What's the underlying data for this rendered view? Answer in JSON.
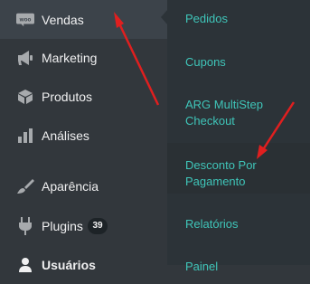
{
  "sidebar": {
    "items": [
      {
        "label": "Vendas",
        "icon": "woo-icon",
        "active": true
      },
      {
        "label": "Marketing",
        "icon": "megaphone-icon"
      },
      {
        "label": "Produtos",
        "icon": "box-icon"
      },
      {
        "label": "Análises",
        "icon": "bar-chart-icon"
      },
      {
        "label": "Aparência",
        "icon": "paintbrush-icon"
      },
      {
        "label": "Plugins",
        "icon": "plug-icon",
        "badge": "39"
      },
      {
        "label": "Usuários",
        "icon": "user-icon"
      }
    ]
  },
  "submenu": {
    "items": [
      {
        "label": "Pedidos"
      },
      {
        "label": "Cupons"
      },
      {
        "label": "ARG MultiStep Checkout"
      },
      {
        "label": "Desconto Por Pagamento"
      },
      {
        "label": "Relatórios"
      },
      {
        "label": "Painel"
      }
    ]
  },
  "colors": {
    "sidebar_bg": "#32373c",
    "submenu_bg": "#2c3338",
    "link": "#3fc5b9",
    "annotation_arrow": "#e01f1f"
  }
}
